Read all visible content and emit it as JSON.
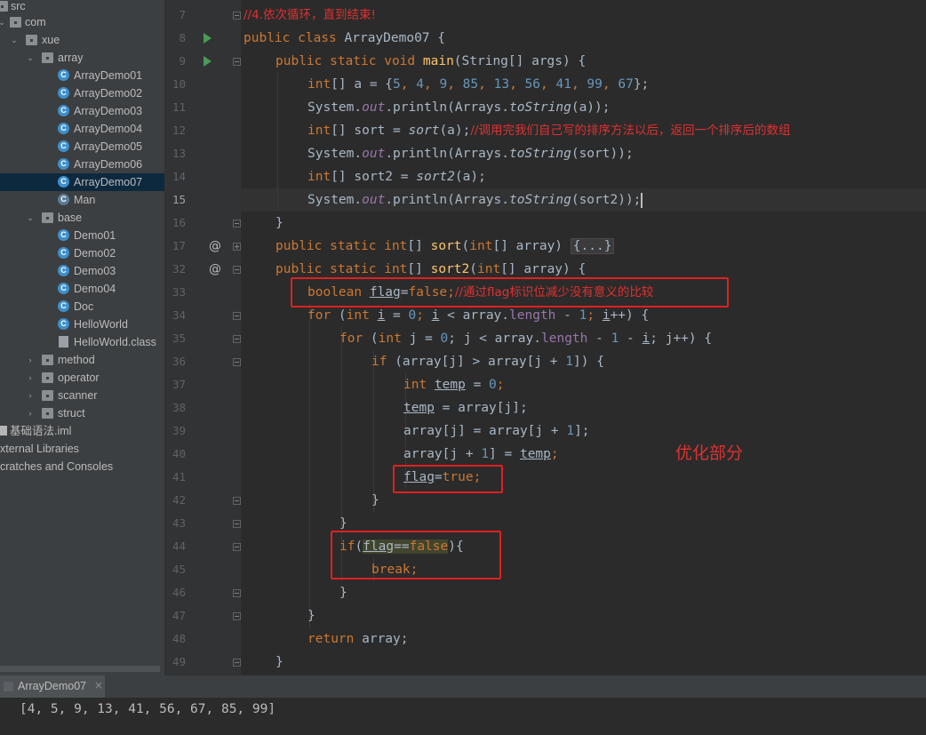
{
  "project_tree": {
    "items": [
      {
        "label": "src",
        "kind": "folder"
      },
      {
        "label": "com",
        "kind": "folder"
      },
      {
        "label": "xue",
        "kind": "folder"
      },
      {
        "label": "array",
        "kind": "folder"
      },
      {
        "label": "ArrayDemo01",
        "kind": "class"
      },
      {
        "label": "ArrayDemo02",
        "kind": "class"
      },
      {
        "label": "ArrayDemo03",
        "kind": "class"
      },
      {
        "label": "ArrayDemo04",
        "kind": "class"
      },
      {
        "label": "ArrayDemo05",
        "kind": "class"
      },
      {
        "label": "ArrayDemo06",
        "kind": "class"
      },
      {
        "label": "ArrayDemo07",
        "kind": "class",
        "selected": true
      },
      {
        "label": "Man",
        "kind": "class"
      },
      {
        "label": "base",
        "kind": "folder"
      },
      {
        "label": "Demo01",
        "kind": "class"
      },
      {
        "label": "Demo02",
        "kind": "class"
      },
      {
        "label": "Demo03",
        "kind": "class"
      },
      {
        "label": "Demo04",
        "kind": "class"
      },
      {
        "label": "Doc",
        "kind": "class"
      },
      {
        "label": "HelloWorld",
        "kind": "class"
      },
      {
        "label": "HelloWorld.class",
        "kind": "classfile"
      },
      {
        "label": "method",
        "kind": "folder"
      },
      {
        "label": "operator",
        "kind": "folder"
      },
      {
        "label": "scanner",
        "kind": "folder"
      },
      {
        "label": "struct",
        "kind": "folder"
      },
      {
        "label": "基础语法.iml",
        "kind": "iml"
      },
      {
        "label": "xternal Libraries",
        "kind": "library"
      },
      {
        "label": "cratches and Consoles",
        "kind": "scratches"
      }
    ]
  },
  "editor": {
    "line_numbers": [
      "7",
      "8",
      "9",
      "10",
      "11",
      "12",
      "13",
      "14",
      "15",
      "16",
      "17",
      "32",
      "33",
      "34",
      "35",
      "36",
      "37",
      "38",
      "39",
      "40",
      "41",
      "42",
      "43",
      "44",
      "45",
      "46",
      "47",
      "48",
      "49"
    ],
    "current_line": "15",
    "code": {
      "l7_comment": "//4.依次循环，直到结束!",
      "l8_a": "public class ",
      "l8_b": "ArrayDemo07 {",
      "l9_a": "public static void ",
      "l9_b": "main",
      "l9_c": "(String[] args) {",
      "l10_a": "int",
      "l10_b": "[] a = {",
      "l10_n1": "5",
      "l10_s1": ", ",
      "l10_n2": "4",
      "l10_s2": ", ",
      "l10_n3": "9",
      "l10_s3": ", ",
      "l10_n4": "85",
      "l10_s4": ", ",
      "l10_n5": "13",
      "l10_s5": ", ",
      "l10_n6": "56",
      "l10_s6": ", ",
      "l10_n7": "41",
      "l10_s7": ", ",
      "l10_n8": "99",
      "l10_s8": ", ",
      "l10_n9": "67",
      "l10_c": "};",
      "l11_a": "System.",
      "l11_b": "out",
      "l11_c": ".println(Arrays.",
      "l11_d": "toString",
      "l11_e": "(a));",
      "l12_a": "int",
      "l12_b": "[] sort = ",
      "l12_c": "sort",
      "l12_d": "(a);",
      "l12_comment": "//调用完我们自己写的排序方法以后，返回一个排序后的数组",
      "l13_a": "System.",
      "l13_b": "out",
      "l13_c": ".println(Arrays.",
      "l13_d": "toString",
      "l13_e": "(sort));",
      "l14_a": "int",
      "l14_b": "[] sort2 = ",
      "l14_c": "sort2",
      "l14_d": "(a);",
      "l15_a": "System.",
      "l15_b": "out",
      "l15_c": ".println(Arrays.",
      "l15_d": "toString",
      "l15_e": "(sort2));",
      "l16": "}",
      "l17_a": "public static int",
      "l17_b": "[] ",
      "l17_c": "sort",
      "l17_d": "(",
      "l17_e": "int",
      "l17_f": "[] array) ",
      "l17_fold": "{...}",
      "l32_a": "public static int",
      "l32_b": "[] ",
      "l32_c": "sort2",
      "l32_d": "(",
      "l32_e": "int",
      "l32_f": "[] array) {",
      "l33_a": "boolean ",
      "l33_b": "flag",
      "l33_c": "=",
      "l33_d": "false",
      "l33_e": ";",
      "l33_comment": "//通过flag标识位减少没有意义的比较",
      "l34_a": "for ",
      "l34_b": "(",
      "l34_c": "int ",
      "l34_d": "i",
      "l34_e": " = ",
      "l34_f": "0",
      "l34_g": "; ",
      "l34_h": "i",
      "l34_i": " < array.",
      "l34_j": "length",
      "l34_k": " - ",
      "l34_l": "1",
      "l34_m": "; ",
      "l34_n": "i",
      "l34_o": "++) {",
      "l35_a": "for ",
      "l35_b": "(",
      "l35_c": "int ",
      "l35_d": "j = ",
      "l35_e": "0",
      "l35_f": "; j < array.",
      "l35_g": "length",
      "l35_h": " - ",
      "l35_i": "1",
      "l35_j": " - ",
      "l35_k": "i",
      "l35_l": "; j++) {",
      "l36_a": "if ",
      "l36_b": "(array[j] > array[j + ",
      "l36_c": "1",
      "l36_d": "]) {",
      "l37_a": "int ",
      "l37_b": "temp",
      "l37_c": " = ",
      "l37_d": "0",
      "l37_e": ";",
      "l38_a": "temp",
      "l38_b": " = array[j];",
      "l39_a": "array[j] = array[j + ",
      "l39_b": "1",
      "l39_c": "];",
      "l40_a": "array[j + ",
      "l40_b": "1",
      "l40_c": "] = ",
      "l40_d": "temp",
      "l40_e": ";",
      "l41_a": "flag",
      "l41_b": "=",
      "l41_c": "true",
      "l41_d": ";",
      "l42": "}",
      "l43": "}",
      "l44_a": "if",
      "l44_b": "(",
      "l44_c": "flag",
      "l44_d": "==",
      "l44_e": "false",
      "l44_f": "){",
      "l45_a": "break",
      "l45_b": ";",
      "l46": "}",
      "l47": "}",
      "l48_a": "return ",
      "l48_b": "array;",
      "l49": "}"
    },
    "annotation": "优化部分"
  },
  "run_panel": {
    "tab_label": "ArrayDemo07",
    "close_glyph": "×",
    "output": "[4, 5, 9, 13, 41, 56, 67, 85, 99]"
  },
  "colors": {
    "keyword": "#cc7832",
    "number": "#6897bb",
    "field": "#9876aa",
    "method": "#ffc66d",
    "comment": "#e03030",
    "highlight_box": "#e02020",
    "selection": "#0d293e"
  }
}
